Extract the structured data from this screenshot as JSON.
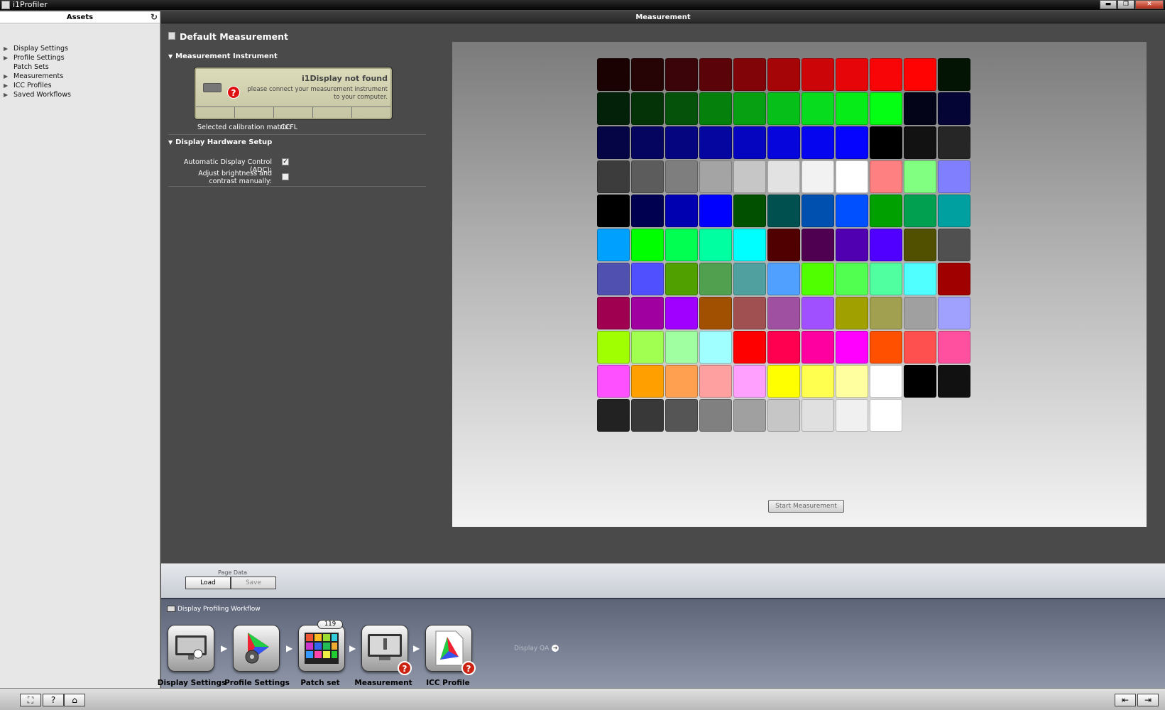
{
  "titlebar": {
    "title": "i1Profiler",
    "minimize": "▬",
    "maximize": "❐",
    "close": "✕"
  },
  "sidebar": {
    "header": "Assets",
    "items": [
      {
        "label": "Display Settings",
        "expandable": true
      },
      {
        "label": "Profile Settings",
        "expandable": true
      },
      {
        "label": "Patch Sets",
        "expandable": false
      },
      {
        "label": "Measurements",
        "expandable": true
      },
      {
        "label": "ICC Profiles",
        "expandable": true
      },
      {
        "label": "Saved Workflows",
        "expandable": true
      }
    ]
  },
  "tab_header": "Measurement",
  "panel": {
    "title": "Default Measurement",
    "instrument_section": "Measurement Instrument",
    "instrument_status": "i1Display not found",
    "instrument_message": "please connect your measurement instrument to your computer.",
    "calibration_label": "Selected calibration matrix:",
    "calibration_value": "CCFL",
    "hardware_section": "Display Hardware Setup",
    "adc_label": "Automatic Display Control (ADC):",
    "adc_checked": true,
    "manual_label": "Adjust brightness and contrast manually:",
    "manual_checked": false
  },
  "patch_colors": [
    "#1a0203",
    "#260305",
    "#3a0408",
    "#5a0409",
    "#800408",
    "#a60508",
    "#cc0508",
    "#e60508",
    "#f80508",
    "#ff0202",
    "#031405",
    "#032108",
    "#053308",
    "#05530a",
    "#05800d",
    "#06a012",
    "#06c019",
    "#07dc1e",
    "#06ec18",
    "#05ff14",
    "#030418",
    "#050535",
    "#050545",
    "#050560",
    "#050580",
    "#0505a0",
    "#0505c0",
    "#0505dc",
    "#0505ef",
    "#0505ff",
    "#000000",
    "#121212",
    "#262626",
    "#3c3c3c",
    "#5c5c5c",
    "#7e7e7e",
    "#a4a4a4",
    "#c6c6c6",
    "#e2e2e2",
    "#f2f2f2",
    "#ffffff",
    "#ff8080",
    "#80ff80",
    "#8080ff",
    "#000000",
    "#000050",
    "#0000b0",
    "#0000ff",
    "#005000",
    "#005050",
    "#0050b0",
    "#0050ff",
    "#00a000",
    "#00a050",
    "#00a0a0",
    "#00a0ff",
    "#00ff00",
    "#00ff50",
    "#00ffa0",
    "#00ffff",
    "#500000",
    "#500050",
    "#5000b0",
    "#5000ff",
    "#505000",
    "#505050",
    "#5050b0",
    "#5050ff",
    "#50a000",
    "#50a050",
    "#50a0a0",
    "#50a0ff",
    "#50ff00",
    "#50ff50",
    "#50ffa0",
    "#50ffff",
    "#a00000",
    "#a00050",
    "#a000a0",
    "#a000ff",
    "#a05000",
    "#a05050",
    "#a050a0",
    "#a050ff",
    "#a0a000",
    "#a0a050",
    "#a0a0a0",
    "#a0a0ff",
    "#a0ff00",
    "#a0ff50",
    "#a0ffa0",
    "#a0ffff",
    "#ff0000",
    "#ff0050",
    "#ff00a0",
    "#ff00ff",
    "#ff5000",
    "#ff5050",
    "#ff50a0",
    "#ff50ff",
    "#ffa000",
    "#ffa050",
    "#ffa0a0",
    "#ffa0ff",
    "#ffff00",
    "#ffff50",
    "#ffffa0",
    "#ffffff",
    "#000000",
    "#111111",
    "#222222",
    "#383838",
    "#555555",
    "#808080",
    "#a0a0a0",
    "#c6c6c6",
    "#e0e0e0",
    "#f0f0f0",
    "#ffffff"
  ],
  "start_button": "Start Measurement",
  "page_data": {
    "label": "Page Data",
    "load": "Load",
    "save": "Save"
  },
  "workflow": {
    "title": "Display Profiling Workflow",
    "steps": [
      {
        "label": "Display Settings",
        "error": false
      },
      {
        "label": "Profile Settings",
        "error": false
      },
      {
        "label": "Patch set",
        "error": false,
        "count": "119"
      },
      {
        "label": "Measurement",
        "error": true
      },
      {
        "label": "ICC Profile",
        "error": true
      }
    ],
    "qa_label": "Display QA"
  },
  "bottombar": {
    "fullscreen": "⛶",
    "help": "?",
    "home": "⌂"
  }
}
